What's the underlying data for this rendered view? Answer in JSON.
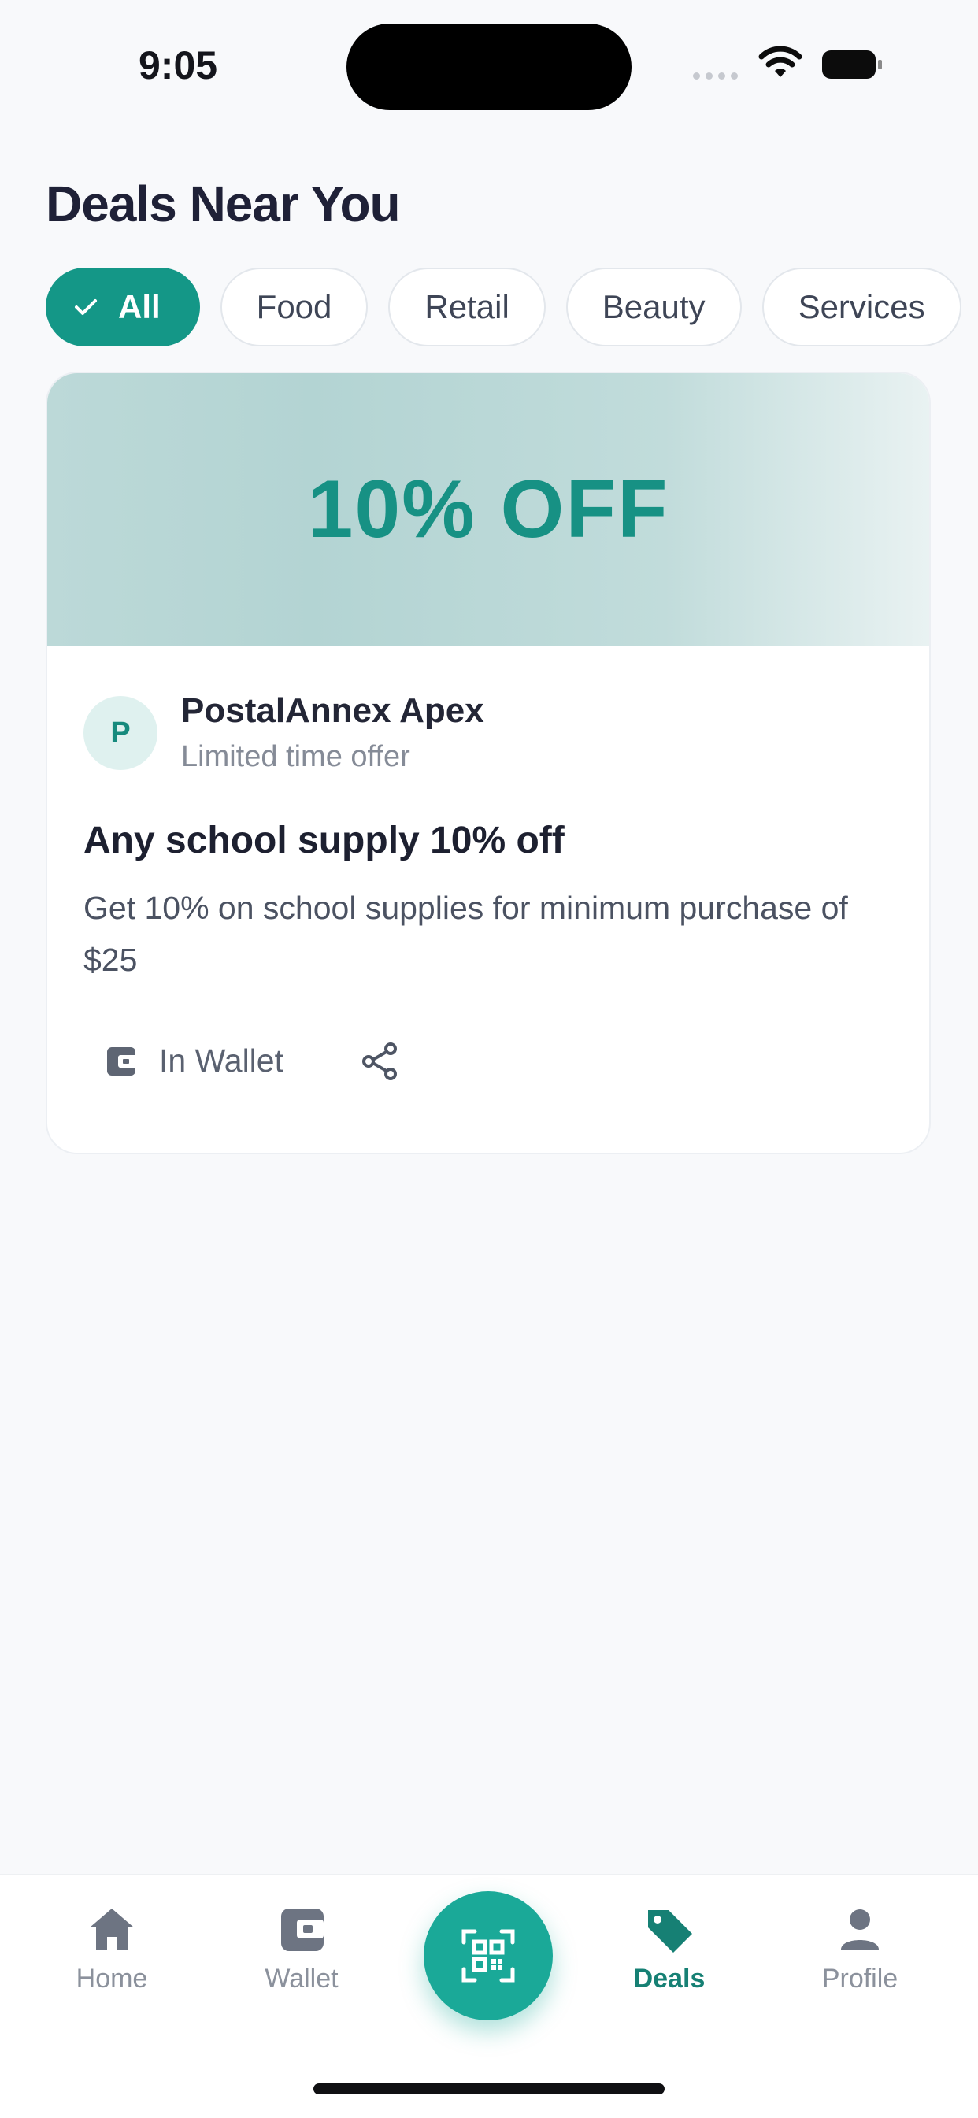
{
  "status": {
    "time": "9:05"
  },
  "page": {
    "title": "Deals Near You"
  },
  "filters": [
    {
      "label": "All",
      "active": true
    },
    {
      "label": "Food",
      "active": false
    },
    {
      "label": "Retail",
      "active": false
    },
    {
      "label": "Beauty",
      "active": false
    },
    {
      "label": "Services",
      "active": false
    }
  ],
  "deal": {
    "banner": "10% OFF",
    "avatar_letter": "P",
    "merchant": "PostalAnnex Apex",
    "subtitle": "Limited time offer",
    "title": "Any school supply 10% off",
    "description": "Get 10% on school supplies for minimum purchase of $25",
    "wallet_label": "In Wallet"
  },
  "nav": {
    "home": "Home",
    "wallet": "Wallet",
    "deals": "Deals",
    "profile": "Profile",
    "active": "Deals"
  },
  "colors": {
    "accent": "#149787",
    "banner_text": "#179184",
    "active_nav": "#168074",
    "muted": "#8b919c"
  },
  "icons": [
    "wifi-icon",
    "battery-icon",
    "check-icon",
    "wallet-icon",
    "share-icon",
    "home-icon",
    "tag-icon",
    "user-icon",
    "qr-scan-icon"
  ]
}
